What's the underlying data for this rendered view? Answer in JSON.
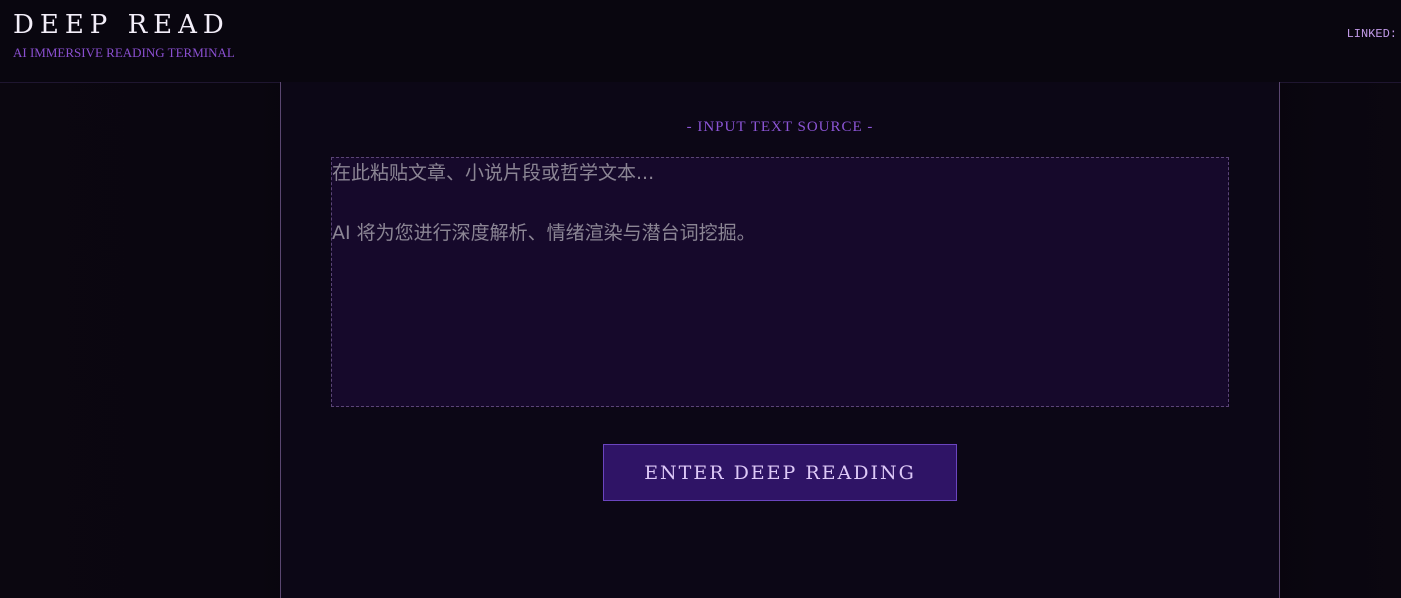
{
  "header": {
    "title": "DEEP READ",
    "subtitle": "AI IMMERSIVE READING TERMINAL",
    "status": "LINKED:"
  },
  "main": {
    "source_label": "- INPUT TEXT SOURCE -",
    "input": {
      "value": "",
      "placeholder": "在此粘贴文章、小说片段或哲学文本...\n\nAI 将为您进行深度解析、情绪渲染与潜台词挖掘。"
    },
    "enter_button_label": "ENTER DEEP READING"
  },
  "colors": {
    "background": "#0b0712",
    "accent": "#8c55d6",
    "button_bg": "#2f1466",
    "textarea_bg": "#16092b"
  }
}
